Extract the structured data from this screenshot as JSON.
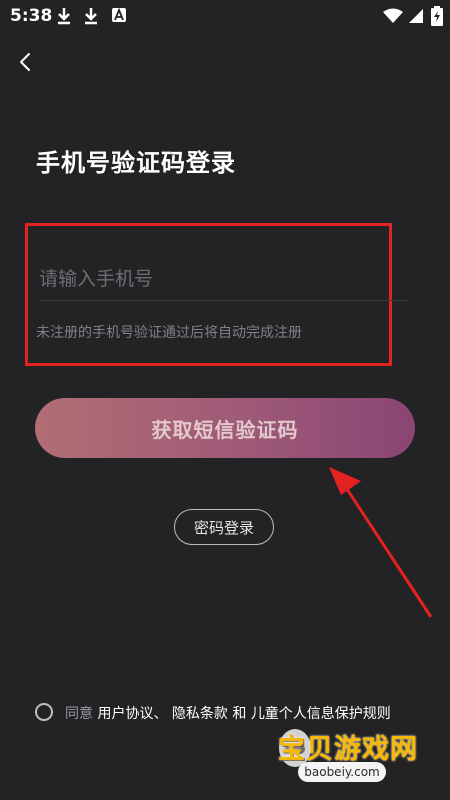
{
  "status_bar": {
    "time": "5:38",
    "icons": [
      "download-icon",
      "download-icon",
      "a-icon",
      "wifi-icon",
      "signal-icon",
      "battery-icon"
    ]
  },
  "page": {
    "title": "手机号验证码登录"
  },
  "phone_field": {
    "placeholder": "请输入手机号",
    "value": ""
  },
  "hint": "未注册的手机号验证通过后将自动完成注册",
  "buttons": {
    "get_code": "获取短信验证码",
    "password_login": "密码登录"
  },
  "agreement": {
    "prefix": "同意",
    "user_agreement": "用户协议",
    "sep1": "、",
    "privacy_policy": "隐私条款",
    "and": "和",
    "child_privacy": "儿童个人信息保护规则"
  },
  "watermark": {
    "main": "宝贝游戏网",
    "sub": "baobeiy.com"
  },
  "colors": {
    "background": "#232326",
    "annotation_red": "#e32222",
    "button_gradient_start": "#b26e73",
    "button_gradient_end": "#8a4574"
  }
}
